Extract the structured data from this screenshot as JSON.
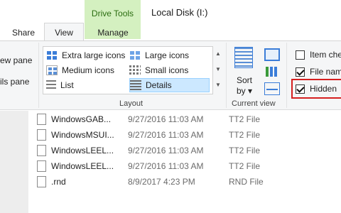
{
  "window": {
    "context_tab": "Drive Tools",
    "title": "Local Disk (I:)"
  },
  "tabs": {
    "share": "Share",
    "view": "View",
    "manage": "Manage"
  },
  "panes": {
    "preview_pane": "ew pane",
    "details_pane": "ils pane"
  },
  "layout": {
    "group_label": "Layout",
    "items": {
      "extra_large": "Extra large icons",
      "large": "Large icons",
      "medium": "Medium icons",
      "small": "Small icons",
      "list": "List",
      "details": "Details"
    },
    "selected": "details"
  },
  "current_view": {
    "group_label": "Current view",
    "sort_line1": "Sort",
    "sort_line2": "by ▾"
  },
  "show_hide": {
    "item_check_boxes": {
      "label": "Item che",
      "checked": false
    },
    "file_name_extensions": {
      "label": "File nam",
      "checked": true
    },
    "hidden_items": {
      "label": "Hidden",
      "checked": true
    }
  },
  "files": [
    {
      "name": "WindowsGAB...",
      "date": "9/27/2016 11:03 AM",
      "type": "TT2 File"
    },
    {
      "name": "WindowsMSUI...",
      "date": "9/27/2016 11:03 AM",
      "type": "TT2 File"
    },
    {
      "name": "WindowsLEEL...",
      "date": "9/27/2016 11:03 AM",
      "type": "TT2 File"
    },
    {
      "name": "WindowsLEEL...",
      "date": "9/27/2016 11:03 AM",
      "type": "TT2 File"
    },
    {
      "name": ".rnd",
      "date": "8/9/2017 4:23 PM",
      "type": "RND File"
    }
  ],
  "colors": {
    "context_tab_bg": "#d4f0c0",
    "context_tab_text": "#2b6d11",
    "selection_bg": "#cce8ff",
    "highlight_border": "#d62020"
  }
}
